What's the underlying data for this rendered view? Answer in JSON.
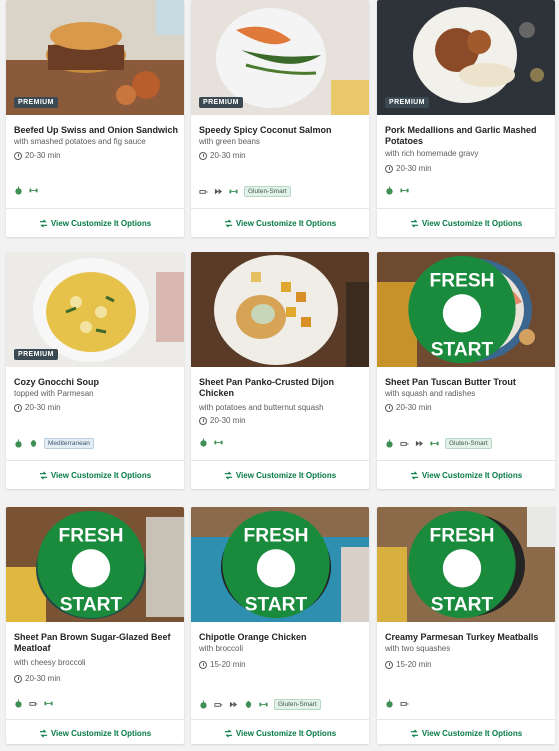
{
  "labels": {
    "premium": "PREMIUM",
    "customize": "View Customize It Options"
  },
  "colors": {
    "brand_green": "#067a46",
    "premium_badge": "#3b4a52",
    "chip_green": "#e4f1ea",
    "chip_blue": "#e6eef5"
  },
  "recipes": [
    {
      "title": "Beefed Up Swiss and Onion Sandwich",
      "subtitle": "with smashed potatoes and fig sauce",
      "time": "20-30 min",
      "premium": true,
      "fresh_start": false,
      "icons": [
        "apple-icon",
        "dumbbell-icon"
      ],
      "chips": []
    },
    {
      "title": "Speedy Spicy Coconut Salmon",
      "subtitle": "with green beans",
      "time": "20-30 min",
      "premium": true,
      "fresh_start": false,
      "icons": [
        "pan-icon",
        "fast-icon",
        "dumbbell-icon"
      ],
      "chips": [
        "Gluten-Smart"
      ]
    },
    {
      "title": "Pork Medallions and Garlic Mashed Potatoes",
      "subtitle": "with rich homemade gravy",
      "time": "20-30 min",
      "premium": true,
      "fresh_start": false,
      "icons": [
        "apple-icon",
        "dumbbell-icon"
      ],
      "chips": []
    },
    {
      "title": "Cozy Gnocchi Soup",
      "subtitle": "topped with Parmesan",
      "time": "20-30 min",
      "premium": true,
      "fresh_start": false,
      "icons": [
        "apple-icon",
        "leaf-icon"
      ],
      "chips": [
        "Mediterranean"
      ]
    },
    {
      "title": "Sheet Pan Panko-Crusted Dijon Chicken",
      "subtitle": "with potatoes and butternut squash",
      "time": "20-30 min",
      "premium": false,
      "fresh_start": false,
      "icons": [
        "apple-icon",
        "dumbbell-icon"
      ],
      "chips": []
    },
    {
      "title": "Sheet Pan Tuscan Butter Trout",
      "subtitle": "with squash and radishes",
      "time": "20-30 min",
      "premium": false,
      "fresh_start": true,
      "icons": [
        "apple-icon",
        "pan-icon",
        "fast-icon",
        "dumbbell-icon"
      ],
      "chips": [
        "Gluten-Smart"
      ]
    },
    {
      "title": "Sheet Pan Brown Sugar-Glazed Beef Meatloaf",
      "subtitle": "with cheesy broccoli",
      "time": "20-30 min",
      "premium": false,
      "fresh_start": true,
      "icons": [
        "apple-icon",
        "pan-icon",
        "dumbbell-icon"
      ],
      "chips": []
    },
    {
      "title": "Chipotle Orange Chicken",
      "subtitle": "with broccoli",
      "time": "15-20 min",
      "premium": false,
      "fresh_start": true,
      "icons": [
        "apple-icon",
        "pan-icon",
        "fast-icon",
        "leaf-icon",
        "dumbbell-icon"
      ],
      "chips": [
        "Gluten-Smart"
      ]
    },
    {
      "title": "Creamy Parmesan Turkey Meatballs",
      "subtitle": "with two squashes",
      "time": "15-20 min",
      "premium": false,
      "fresh_start": true,
      "icons": [
        "apple-icon",
        "pan-icon"
      ],
      "chips": []
    }
  ]
}
